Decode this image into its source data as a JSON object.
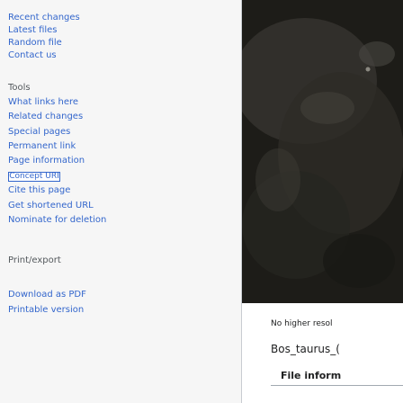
{
  "sidebar": {
    "top_links": [
      {
        "label": "Recent changes"
      },
      {
        "label": "Latest files"
      },
      {
        "label": "Random file"
      },
      {
        "label": "Contact us"
      }
    ],
    "tools_heading": "Tools",
    "tools_links": [
      {
        "label": "What links here"
      },
      {
        "label": "Related changes"
      },
      {
        "label": "Special pages"
      },
      {
        "label": "Permanent link"
      },
      {
        "label": "Page information"
      }
    ],
    "concept_uri": "Concept URI",
    "tools_links_2": [
      {
        "label": "Cite this page"
      },
      {
        "label": "Get shortened URL"
      },
      {
        "label": "Nominate for deletion"
      }
    ],
    "print_heading": "Print/export",
    "print_links": [
      {
        "label": "Download as PDF"
      },
      {
        "label": "Printable version"
      }
    ]
  },
  "content": {
    "no_higher_resolution": "No higher resol",
    "file_name": "Bos_taurus_(",
    "file_info_heading": "File inform"
  },
  "colors": {
    "link": "#3366cc",
    "text": "#202122",
    "heading": "#54595d"
  }
}
